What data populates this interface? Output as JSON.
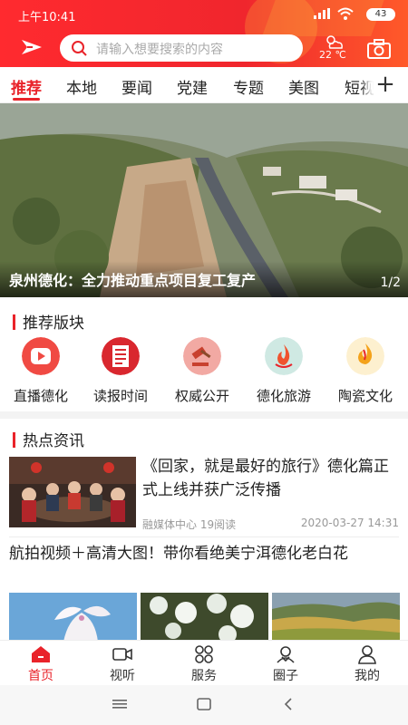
{
  "status_bar": {
    "time": "上午10:41",
    "battery": "43"
  },
  "search": {
    "placeholder": "请输入想要搜索的内容"
  },
  "weather": {
    "temperature": "22 ℃",
    "icon": "cloudy-sun-icon"
  },
  "tabs": [
    {
      "label": "推荐",
      "active": true
    },
    {
      "label": "本地"
    },
    {
      "label": "要闻"
    },
    {
      "label": "党建"
    },
    {
      "label": "专题"
    },
    {
      "label": "美图"
    },
    {
      "label": "短视"
    }
  ],
  "banner": {
    "caption": "泉州德化：全力推动重点项目复工复产",
    "pager": "1/2"
  },
  "recommended": {
    "title": "推荐版块",
    "items": [
      {
        "label": "直播德化",
        "icon": "live-play-icon",
        "color": "#f04a43"
      },
      {
        "label": "读报时间",
        "icon": "newspaper-icon",
        "color": "#d9272e"
      },
      {
        "label": "权威公开",
        "icon": "gavel-icon",
        "color": "#f2a9a3"
      },
      {
        "label": "德化旅游",
        "icon": "flame-travel-icon",
        "color": "#cfe9e3"
      },
      {
        "label": "陶瓷文化",
        "icon": "flame-ceramic-icon",
        "color": "#fdf0cf"
      }
    ]
  },
  "hot": {
    "title": "热点资讯",
    "news": [
      {
        "title": "《回家，就是最好的旅行》德化篇正式上线并获广泛传播",
        "source": "融媒体中心 19阅读",
        "time": "2020-03-27 14:31"
      },
      {
        "title": "航拍视频＋高清大图！带你看绝美宁洱德化老白花"
      }
    ]
  },
  "bottom_nav": [
    {
      "label": "首页",
      "icon": "home-icon",
      "active": true
    },
    {
      "label": "视听",
      "icon": "video-icon"
    },
    {
      "label": "服务",
      "icon": "grid-icon"
    },
    {
      "label": "圈子",
      "icon": "community-icon"
    },
    {
      "label": "我的",
      "icon": "user-icon"
    }
  ],
  "colors": {
    "brand": "#e9232a",
    "header_start": "#ff2a2f",
    "header_end": "#ff5a2a"
  }
}
